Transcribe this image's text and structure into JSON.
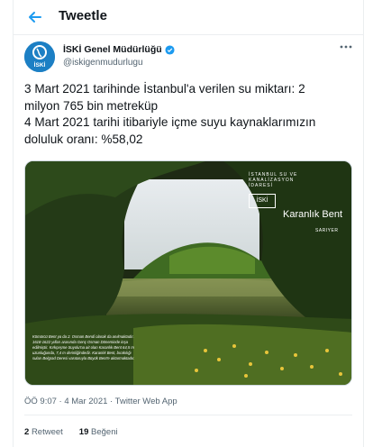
{
  "header": {
    "title": "Tweetle"
  },
  "author": {
    "name": "İSKİ Genel Müdürlüğü",
    "handle": "@iskigenmudurlugu",
    "avatar_text": "İSKİ"
  },
  "tweet": {
    "lines": [
      "3 Mart 2021 tarihinde İstanbul'a verilen su miktarı: 2",
      "milyon 765 bin metreküp",
      "4 Mart 2021 tarihi itibariyle içme suyu kaynaklarımızın",
      "doluluk oranı: %58,02"
    ]
  },
  "media": {
    "brand_small": "İSTANBUL SU VE KANALİZASYON İDARESİ",
    "brand_logo": "İSKİ",
    "title": "Karanlık Bent",
    "location": "SARIYER",
    "caption": "Kömürcü Bent ya da 2. Osman Bendi olarak da anılmaktadır. 1618-1622 yılları arasında Genç Osman Döneminde inşa edilmiştir. Kırkçeşme Suyolu'na ait olan Karanlık Bent 64,5 m uzunluğunda, 7,4 m derinliğindedir. Karanlık Bent, bırakılığı suları Belgrad Deresi vasıtasıyla Büyük Bent'e aktarmaktadır."
  },
  "meta": {
    "time_date_source": "ÖÖ 9:07 · 4 Mar 2021 · Twitter Web App"
  },
  "stats": {
    "retweet_count": "2",
    "retweet_label": "Retweet",
    "like_count": "19",
    "like_label": "Beğeni"
  },
  "colors": {
    "accent": "#1d9bf0",
    "text": "#0f1419",
    "muted": "#536471"
  }
}
